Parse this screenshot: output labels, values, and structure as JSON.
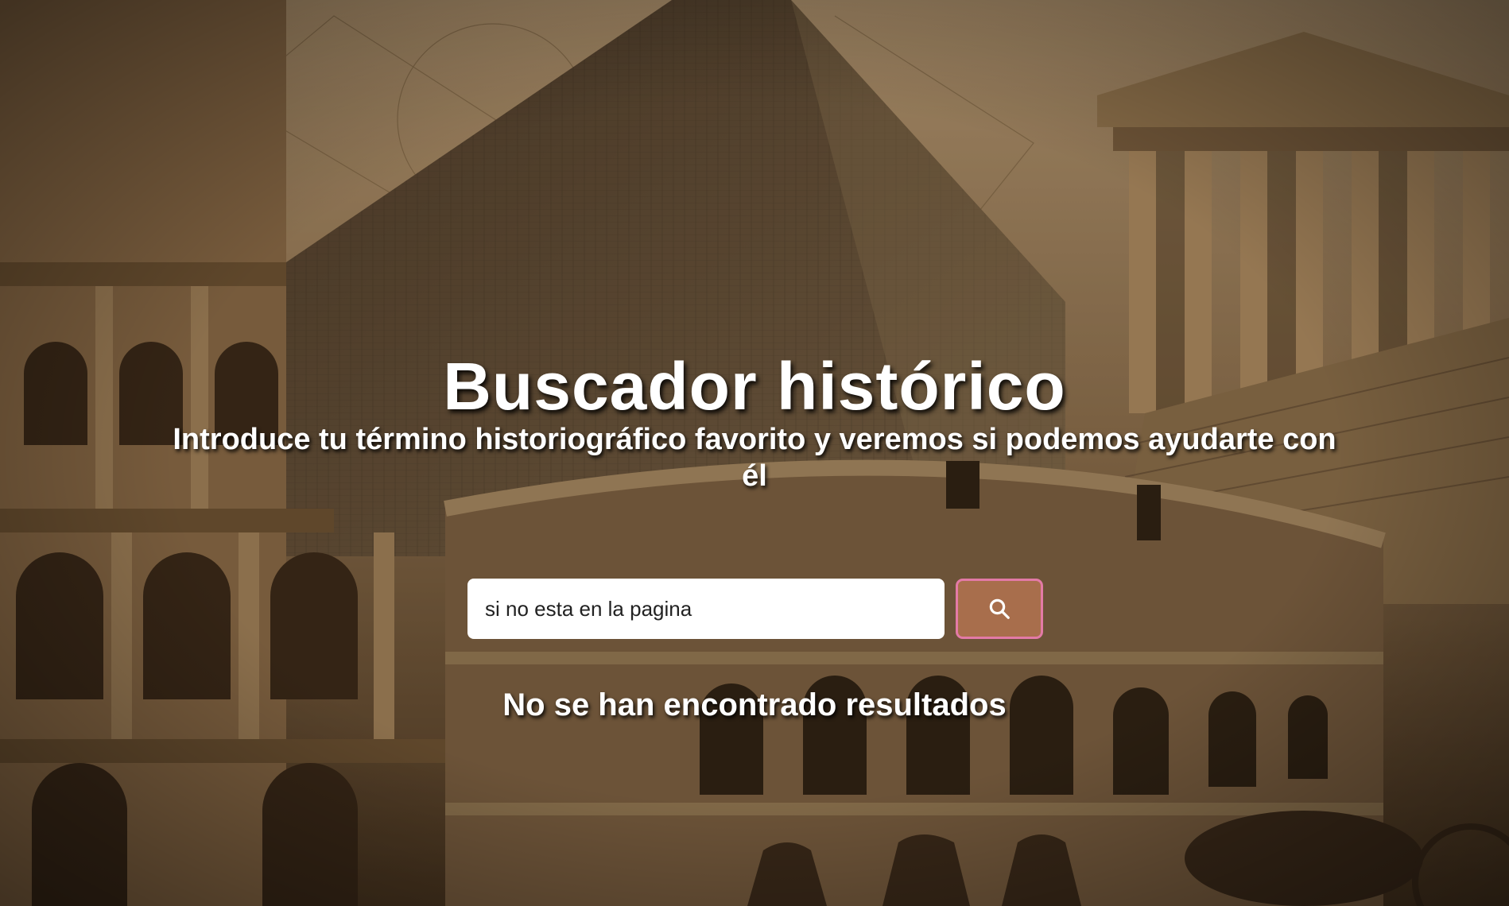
{
  "header": {
    "title": "Buscador histórico",
    "subtitle": "Introduce tu término historiográfico favorito y veremos si podemos ayudarte con él"
  },
  "search": {
    "value": "si no esta en la pagina",
    "button_icon": "search-icon"
  },
  "results": {
    "message": "No se han encontrado resultados"
  },
  "background": {
    "image_theme": "sepia collage of ancient monuments: Colosseum, pyramid, Greek temple, horses"
  },
  "colors": {
    "button_bg": "#a86e4c",
    "button_border": "#e37aa6",
    "text": "#ffffff"
  }
}
